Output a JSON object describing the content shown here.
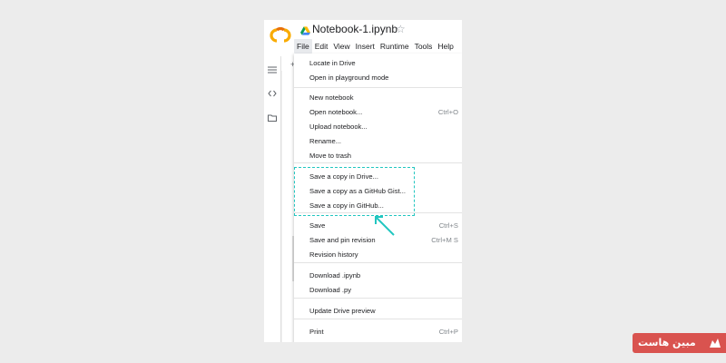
{
  "notebook": {
    "title": "Notebook-1.ipynb"
  },
  "colors": {
    "accent_highlight": "#22c6c0",
    "logo_orange": "#f9ab00",
    "badge_red": "#d9534f"
  },
  "icons": {
    "logo": "colab-logo",
    "drive": "google-drive-icon",
    "star": "star-outline-icon",
    "rail": [
      "table-of-contents-icon",
      "code-icon",
      "folder-icon"
    ]
  },
  "menubar": [
    "File",
    "Edit",
    "View",
    "Insert",
    "Runtime",
    "Tools",
    "Help"
  ],
  "file_menu": [
    {
      "label": "Locate in Drive",
      "shortcut": ""
    },
    {
      "label": "Open in playground mode",
      "shortcut": ""
    },
    {
      "label": "New notebook",
      "shortcut": ""
    },
    {
      "label": "Open notebook...",
      "shortcut": "Ctrl+O"
    },
    {
      "label": "Upload notebook...",
      "shortcut": ""
    },
    {
      "label": "Rename...",
      "shortcut": ""
    },
    {
      "label": "Move to trash",
      "shortcut": ""
    },
    {
      "label": "Save a copy in Drive...",
      "shortcut": ""
    },
    {
      "label": "Save a copy as a GitHub Gist...",
      "shortcut": ""
    },
    {
      "label": "Save a copy in GitHub...",
      "shortcut": ""
    },
    {
      "label": "Save",
      "shortcut": "Ctrl+S"
    },
    {
      "label": "Save and pin revision",
      "shortcut": "Ctrl+M S"
    },
    {
      "label": "Revision history",
      "shortcut": ""
    },
    {
      "label": "Download .ipynb",
      "shortcut": ""
    },
    {
      "label": "Download .py",
      "shortcut": ""
    },
    {
      "label": "Update Drive preview",
      "shortcut": ""
    },
    {
      "label": "Print",
      "shortcut": "Ctrl+P"
    }
  ],
  "watermark": {
    "text": "مبین هاست"
  }
}
